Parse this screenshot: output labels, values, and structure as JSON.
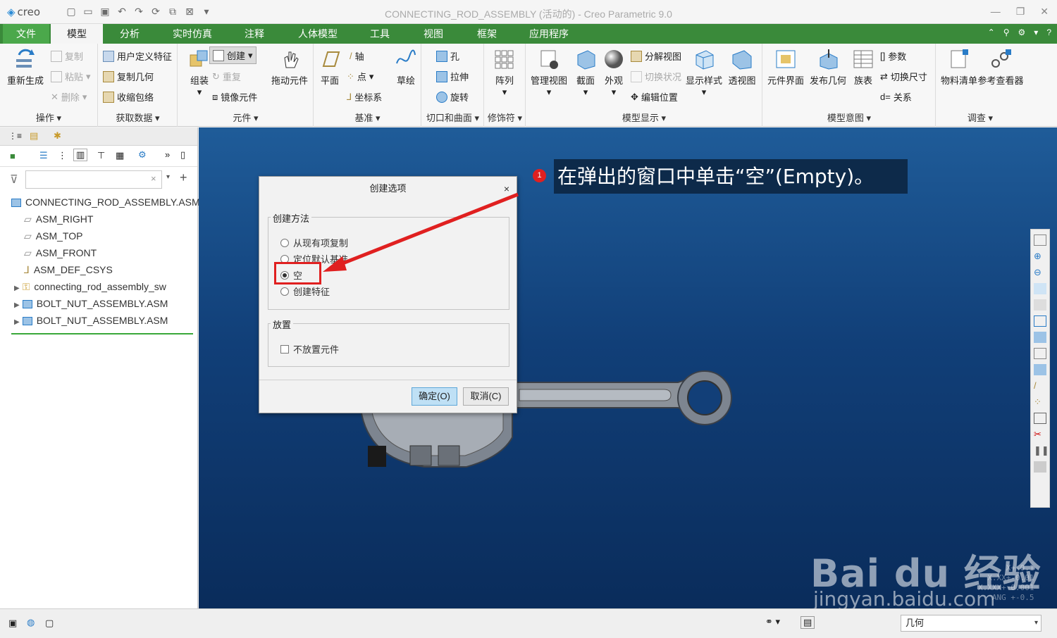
{
  "window": {
    "app_logo": "creo",
    "title": "CONNECTING_ROD_ASSEMBLY (活动的) - Creo Parametric 9.0"
  },
  "ribbon_tabs": [
    "文件",
    "模型",
    "分析",
    "实时仿真",
    "注释",
    "人体模型",
    "工具",
    "视图",
    "框架",
    "应用程序"
  ],
  "ribbon": {
    "regenerate": "重新生成",
    "copy": "复制",
    "paste": "粘贴",
    "delete": "删除",
    "operations": "操作",
    "udf": "用户定义特征",
    "copy_geometry": "复制几何",
    "shrinkwrap": "收缩包络",
    "get_data": "获取数据",
    "assemble": "组装",
    "create": "创建",
    "repeat": "重复",
    "mirror_component": "镜像元件",
    "drag_components": "拖动元件",
    "components": "元件",
    "plane": "平面",
    "axis": "轴",
    "point": "点",
    "csys": "坐标系",
    "sketch": "草绘",
    "datum": "基准",
    "hole": "孔",
    "extrude": "拉伸",
    "revolve": "旋转",
    "cut_surface": "切口和曲面",
    "pattern": "阵列",
    "modifiers": "修饰符",
    "manage_views": "管理视图",
    "section": "截面",
    "appearance": "外观",
    "explode_view": "分解视图",
    "toggle_status": "切换状况",
    "edit_position": "编辑位置",
    "display_style": "显示样式",
    "perspective": "透视图",
    "model_display": "模型显示",
    "component_interface": "元件界面",
    "publish_geometry": "发布几何",
    "family_table": "族表",
    "parameters": "参数",
    "switch_dimensions": "切换尺寸",
    "relations": "关系",
    "model_intent": "模型意图",
    "bom": "物料清单",
    "reference_viewer": "参考查看器",
    "investigate": "调查"
  },
  "tree": {
    "search_placeholder": "",
    "items": [
      {
        "label": "CONNECTING_ROD_ASSEMBLY.ASM",
        "type": "assembly"
      },
      {
        "label": "ASM_RIGHT",
        "type": "plane"
      },
      {
        "label": "ASM_TOP",
        "type": "plane"
      },
      {
        "label": "ASM_FRONT",
        "type": "plane"
      },
      {
        "label": "ASM_DEF_CSYS",
        "type": "csys"
      },
      {
        "label": "connecting_rod_assembly_sw",
        "type": "part"
      },
      {
        "label": "BOLT_NUT_ASSEMBLY.ASM",
        "type": "subassembly"
      },
      {
        "label": "BOLT_NUT_ASSEMBLY.ASM",
        "type": "subassembly"
      }
    ]
  },
  "dialog": {
    "title": "创建选项",
    "close": "×",
    "method_group": "创建方法",
    "options": [
      "从现有项复制",
      "定位默认基准",
      "空",
      "创建特征"
    ],
    "selected_option": "空",
    "placement_group": "放置",
    "no_placement": "不放置元件",
    "ok": "确定(O)",
    "cancel": "取消(C)"
  },
  "annotation": {
    "step": "1",
    "text": "在弹出的窗口中单击“空”(Empty)。"
  },
  "watermark": {
    "brand": "Bai du 经验",
    "url": "jingyan.baidu.com"
  },
  "tolerance": [
    "X+-0.1",
    "X.XX+-0.01",
    "X.XXX+-0.001",
    "ANG +-0.5"
  ],
  "statusbar": {
    "filter_value": "几何"
  },
  "colors": {
    "tab_bar": "#3a8a3a",
    "viewport_top": "#1f5c99",
    "viewport_bottom": "#0a2c5b",
    "highlight": "#e02020"
  }
}
